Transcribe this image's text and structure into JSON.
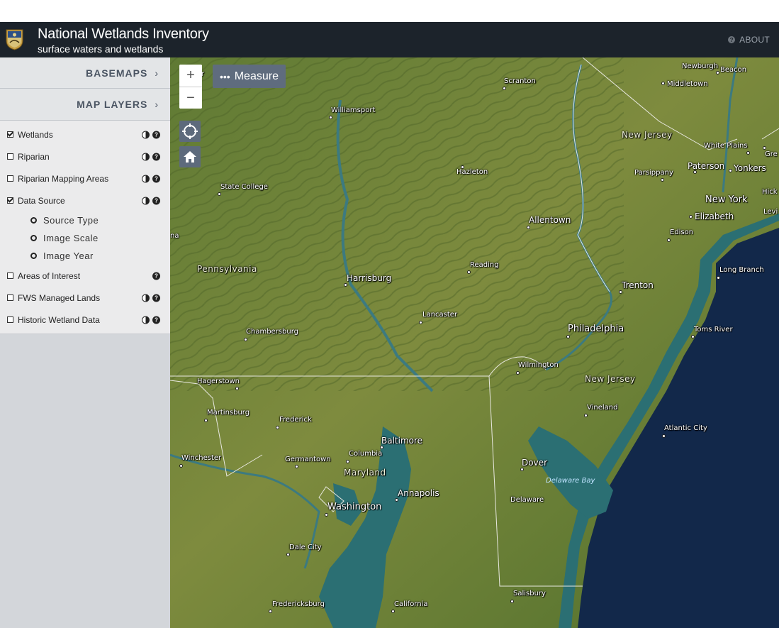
{
  "colors": {
    "header_bg": "#1c232b",
    "sidebar_bg": "#d3d6da",
    "map_land": "#6b8236",
    "map_water": "#2b6f73",
    "ocean": "#12284a",
    "control_bg": "#5d6a7c"
  },
  "header": {
    "title": "National Wetlands Inventory",
    "subtitle": "surface waters and wetlands",
    "about_label": "ABOUT",
    "logo_icon": "usfws-shield-icon",
    "about_icon": "question-circle-icon"
  },
  "sidebar": {
    "basemaps_label": "BASEMAPS",
    "map_layers_label": "MAP LAYERS",
    "layers": [
      {
        "label": "Wetlands",
        "checked": true,
        "opacity_icon": true,
        "help_icon": true
      },
      {
        "label": "Riparian",
        "checked": false,
        "opacity_icon": true,
        "help_icon": true
      },
      {
        "label": "Riparian Mapping Areas",
        "checked": false,
        "opacity_icon": true,
        "help_icon": true
      },
      {
        "label": "Data Source",
        "checked": true,
        "opacity_icon": true,
        "help_icon": true
      },
      {
        "label": "Areas of Interest",
        "checked": false,
        "opacity_icon": false,
        "help_icon": true
      },
      {
        "label": "FWS Managed Lands",
        "checked": false,
        "opacity_icon": true,
        "help_icon": true
      },
      {
        "label": "Historic Wetland Data",
        "checked": false,
        "opacity_icon": true,
        "help_icon": true
      }
    ],
    "data_source_options": [
      "Source Type",
      "Image Scale",
      "Image Year"
    ]
  },
  "map": {
    "zoom_in": "+",
    "zoom_out": "−",
    "measure_label": "Measure",
    "measure_icon": "ellipsis-icon",
    "locate_icon": "crosshair-icon",
    "home_icon": "home-icon",
    "labels": {
      "newburgh": "Newburgh",
      "beacon": "Beacon",
      "middletown": "Middletown",
      "scranton": "Scranton",
      "williamsport": "Williamsport",
      "new_jersey_n": "New Jersey",
      "white_plains": "White Plains",
      "gre": "Gre",
      "parsippany": "Parsippany",
      "paterson": "Paterson",
      "yonkers": "Yonkers",
      "hick": "Hick",
      "hazleton": "Hazleton",
      "state_college": "State College",
      "new_york": "New York",
      "levi": "Levi",
      "elizabeth": "Elizabeth",
      "allentown": "Allentown",
      "edison": "Edison",
      "na": "na",
      "pennsylvania": "Pennsylvania",
      "reading": "Reading",
      "long_branch": "Long Branch",
      "harrisburg": "Harrisburg",
      "trenton": "Trenton",
      "lancaster": "Lancaster",
      "philadelphia": "Philadelphia",
      "toms_river": "Toms River",
      "chambersburg": "Chambersburg",
      "wilmington": "Wilmington",
      "hagerstown": "Hagerstown",
      "new_jersey_s": "New Jersey",
      "vineland": "Vineland",
      "martinsburg": "Martinsburg",
      "frederick": "Frederick",
      "atlantic_city": "Atlantic City",
      "baltimore": "Baltimore",
      "winchester": "Winchester",
      "germantown": "Germantown",
      "columbia": "Columbia",
      "maryland": "Maryland",
      "dover": "Dover",
      "delaware_bay": "Delaware Bay",
      "annapolis": "Annapolis",
      "delaware": "Delaware",
      "washington": "Washington",
      "dale_city": "Dale City",
      "salisbury": "Salisbury",
      "fredericksburg": "Fredericksburg",
      "california": "California",
      "per": "Per"
    }
  }
}
